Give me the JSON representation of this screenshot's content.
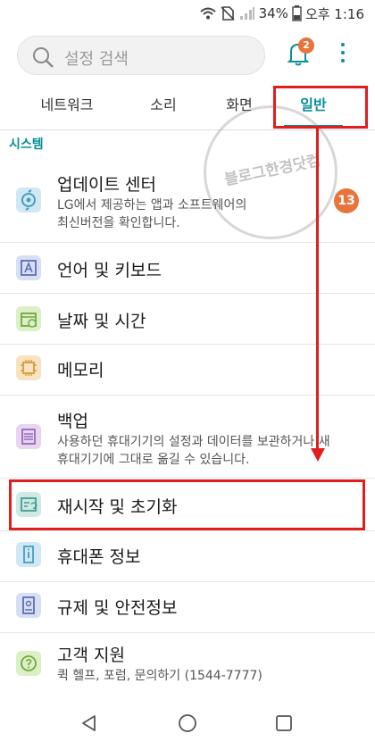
{
  "status_bar": {
    "battery": "34%",
    "time": "오후 1:16"
  },
  "search": {
    "placeholder": "설정 검색"
  },
  "notifications": {
    "count": "2"
  },
  "tabs": [
    {
      "label": "네트워크"
    },
    {
      "label": "소리"
    },
    {
      "label": "화면"
    },
    {
      "label": "일반",
      "active": true
    }
  ],
  "section_title": "시스템",
  "items": [
    {
      "title": "업데이트 센터",
      "subtitle": [
        "LG에서 제공하는 앱과 소프트웨어의",
        "최신버전을 확인합니다."
      ],
      "badge": "13",
      "icon": "update-icon"
    },
    {
      "title": "언어 및 키보드",
      "icon": "language-icon"
    },
    {
      "title": "날짜 및 시간",
      "icon": "calendar-icon"
    },
    {
      "title": "메모리",
      "icon": "memory-chip-icon"
    },
    {
      "title": "백업",
      "subtitle": [
        "사용하던 휴대기기의 설정과 데이터를 보관하거나 새",
        "휴대기기에 그대로 옮길 수 있습니다."
      ],
      "icon": "backup-icon"
    },
    {
      "title": "재시작 및 초기화",
      "icon": "reset-icon"
    },
    {
      "title": "휴대폰 정보",
      "icon": "phone-info-icon"
    },
    {
      "title": "규제 및 안전정보",
      "icon": "regulatory-icon"
    },
    {
      "title": "고객 지원",
      "subtitle": [
        "퀵 헬프, 포럼, 문의하기 (1544-7777)"
      ],
      "icon": "help-icon"
    }
  ],
  "watermark_text": "블로그한경닷컴",
  "colors": {
    "accent": "#0a8f97",
    "badge": "#e8743b",
    "annotation": "#e01e1e"
  }
}
